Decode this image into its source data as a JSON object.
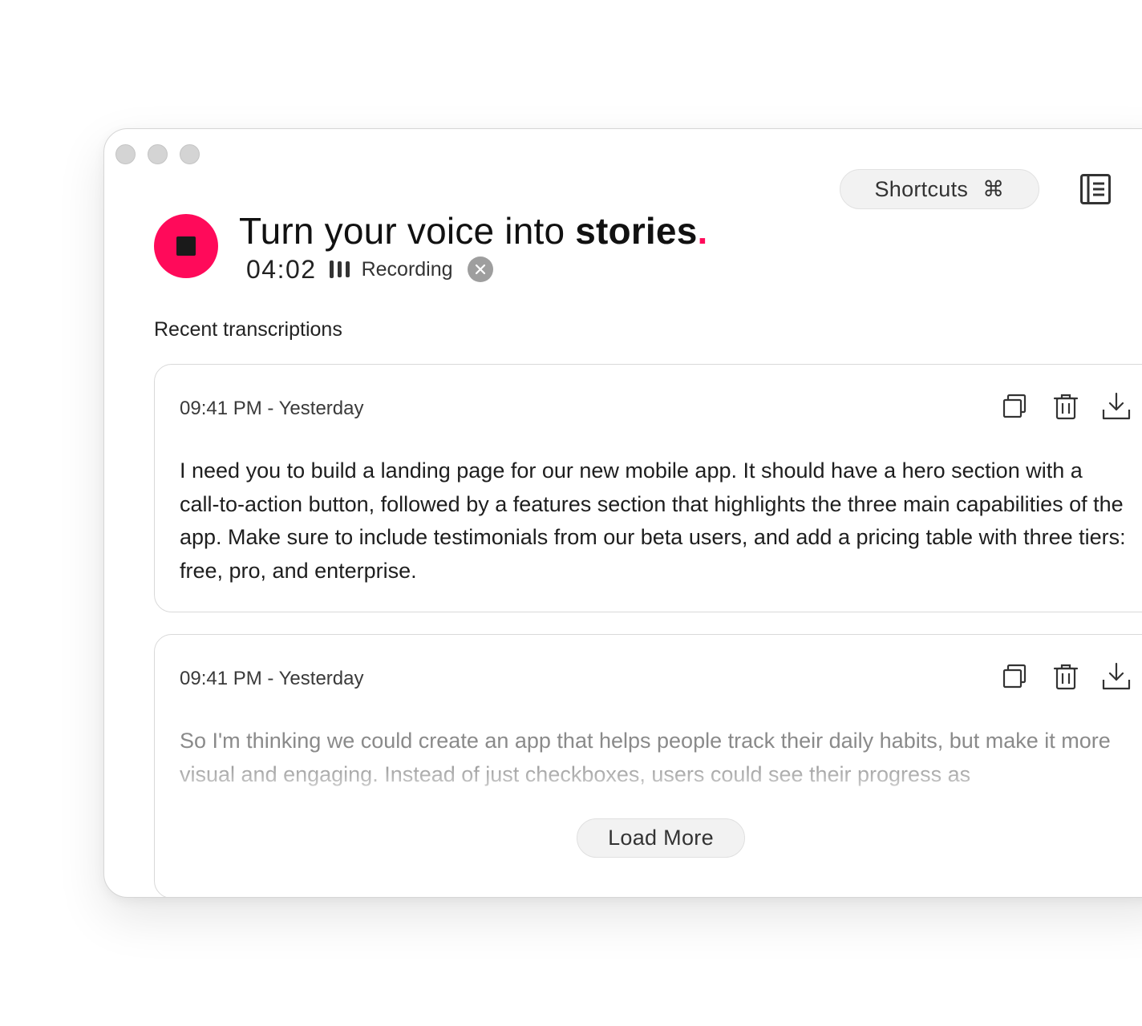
{
  "header": {
    "shortcuts_label": "Shortcuts",
    "shortcuts_key": "⌘",
    "notes_icon": "notebook-icon"
  },
  "hero": {
    "headline_prefix": "Turn your voice into ",
    "headline_bold": "stories",
    "headline_dot": "."
  },
  "recording": {
    "timer": "04:02",
    "status_label": "Recording",
    "state": "recording"
  },
  "recent": {
    "title": "Recent transcriptions",
    "items": [
      {
        "time": "09:41 PM - Yesterday",
        "text": "I need you to build a landing page for our new mobile app. It should have a hero section with a call-to-action button, followed by a features section that highlights the three main capabilities of the app. Make sure to include testimonials from our beta users, and add a pricing table with three tiers: free, pro, and enterprise."
      },
      {
        "time": "09:41 PM - Yesterday",
        "text": "So I'm thinking we could create an app that helps people track their daily habits, but make it more visual and engaging. Instead of just checkboxes, users could see their progress as"
      }
    ],
    "load_more_label": "Load More"
  },
  "colors": {
    "accent": "#ff0a5a",
    "traffic_light": "#d4d4d4"
  }
}
